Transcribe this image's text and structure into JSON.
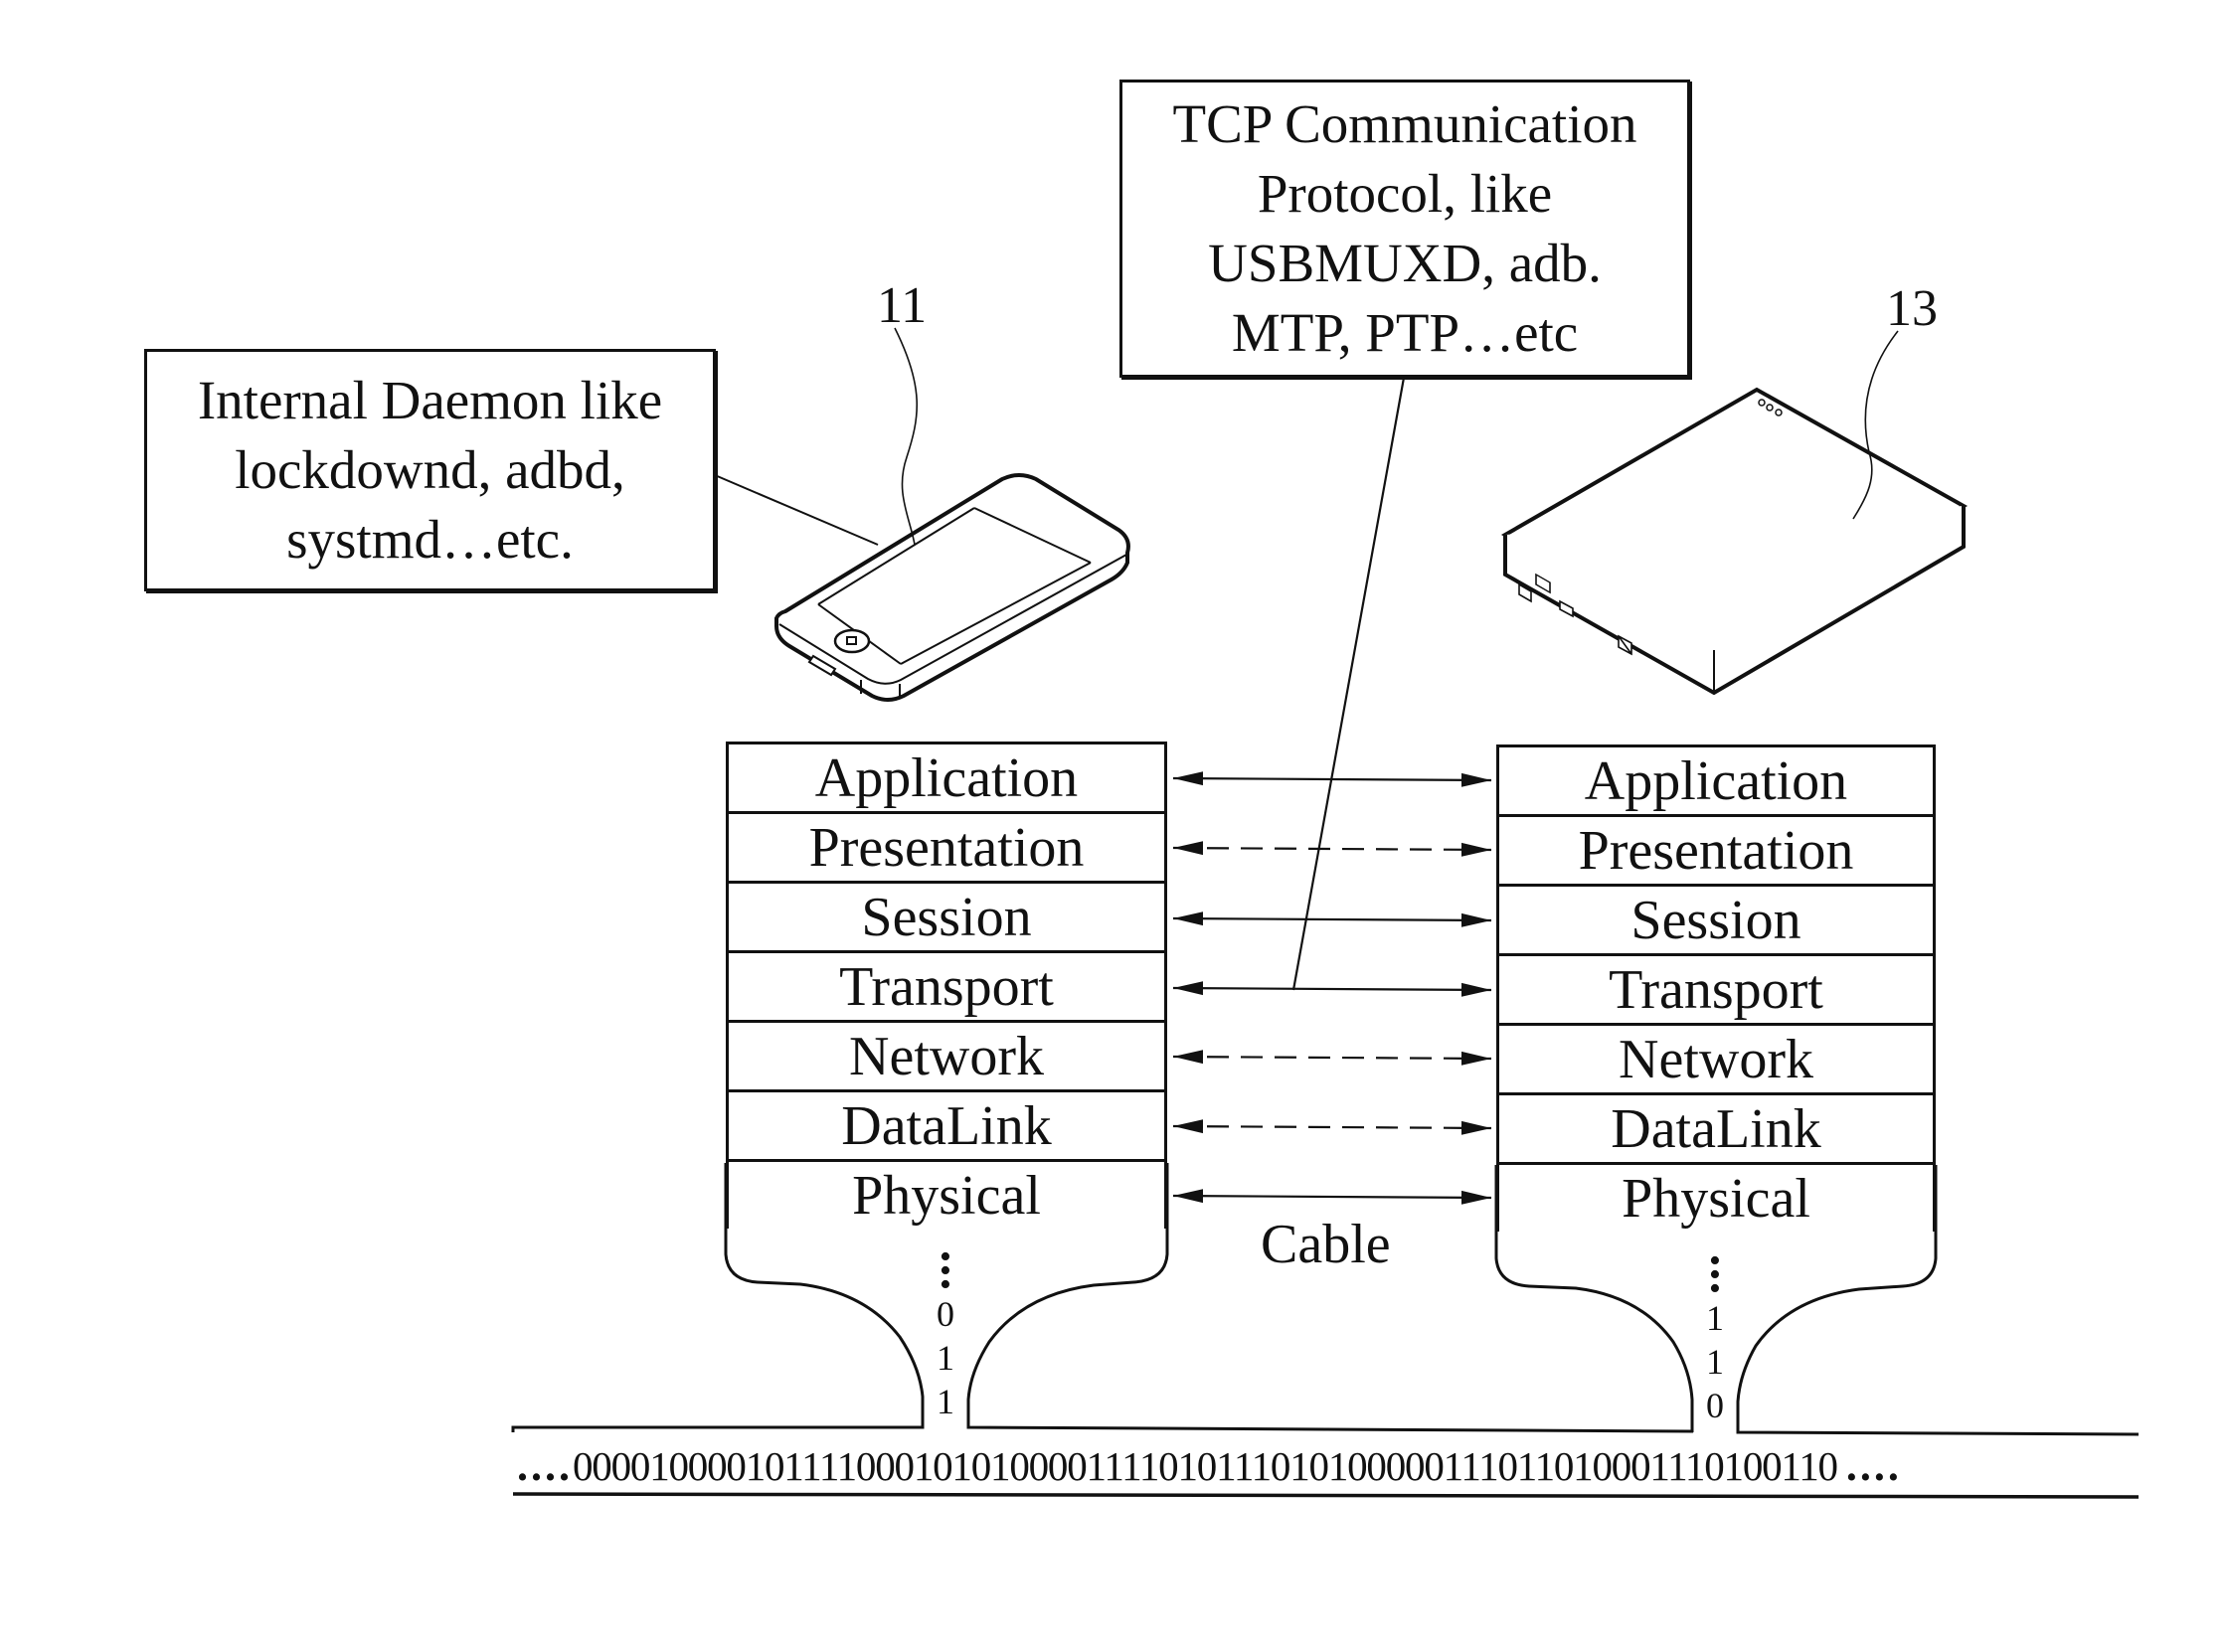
{
  "callouts": {
    "daemon": {
      "lines": [
        "Internal Daemon like",
        "lockdownd, adbd,",
        "systmd…etc."
      ]
    },
    "tcp": {
      "lines": [
        "TCP Communication",
        "Protocol, like",
        "USBMUXD, adb.",
        "MTP, PTP…etc"
      ]
    }
  },
  "devices": {
    "phone": {
      "ref": "11",
      "icon": "smartphone-icon"
    },
    "host": {
      "ref": "13",
      "icon": "host-box-icon"
    }
  },
  "stacks": {
    "left": {
      "layers": [
        "Application",
        "Presentation",
        "Session",
        "Transport",
        "Network",
        "DataLink",
        "Physical"
      ],
      "neck_bits": [
        "0",
        "1",
        "1"
      ]
    },
    "right": {
      "layers": [
        "Application",
        "Presentation",
        "Session",
        "Transport",
        "Network",
        "DataLink",
        "Physical"
      ],
      "neck_bits": [
        "1",
        "1",
        "0"
      ]
    }
  },
  "links": [
    {
      "layer": "Application",
      "style": "solid"
    },
    {
      "layer": "Presentation",
      "style": "dashed"
    },
    {
      "layer": "Session",
      "style": "solid"
    },
    {
      "layer": "Transport",
      "style": "solid"
    },
    {
      "layer": "Network",
      "style": "dashed"
    },
    {
      "layer": "DataLink",
      "style": "dashed"
    },
    {
      "layer": "Physical",
      "style": "solid"
    }
  ],
  "cable_label": "Cable",
  "bitstream": {
    "leading": "....",
    "bits": "0000100001011110001010100001111010111010100000111011010001110100110",
    "trailing": "...."
  }
}
